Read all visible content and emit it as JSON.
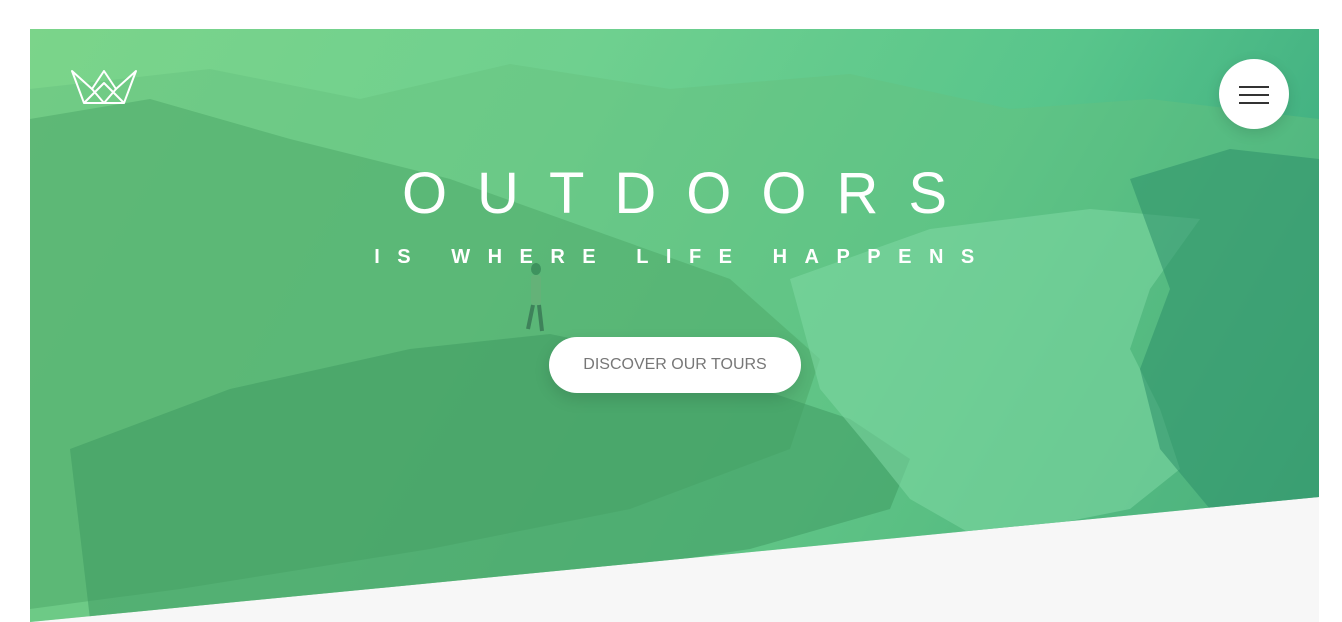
{
  "header": {
    "logo_icon": "crown-outline-logo",
    "menu_icon": "hamburger-menu-icon"
  },
  "hero": {
    "title": "OUTDOORS",
    "subtitle": "IS WHERE LIFE HAPPENS",
    "cta_label": "DISCOVER OUR TOURS"
  },
  "colors": {
    "gradient_start": "#7bd48a",
    "gradient_end": "#2f9f7a",
    "section_background": "#f7f7f7",
    "button_background": "#ffffff",
    "button_text": "#777777"
  }
}
